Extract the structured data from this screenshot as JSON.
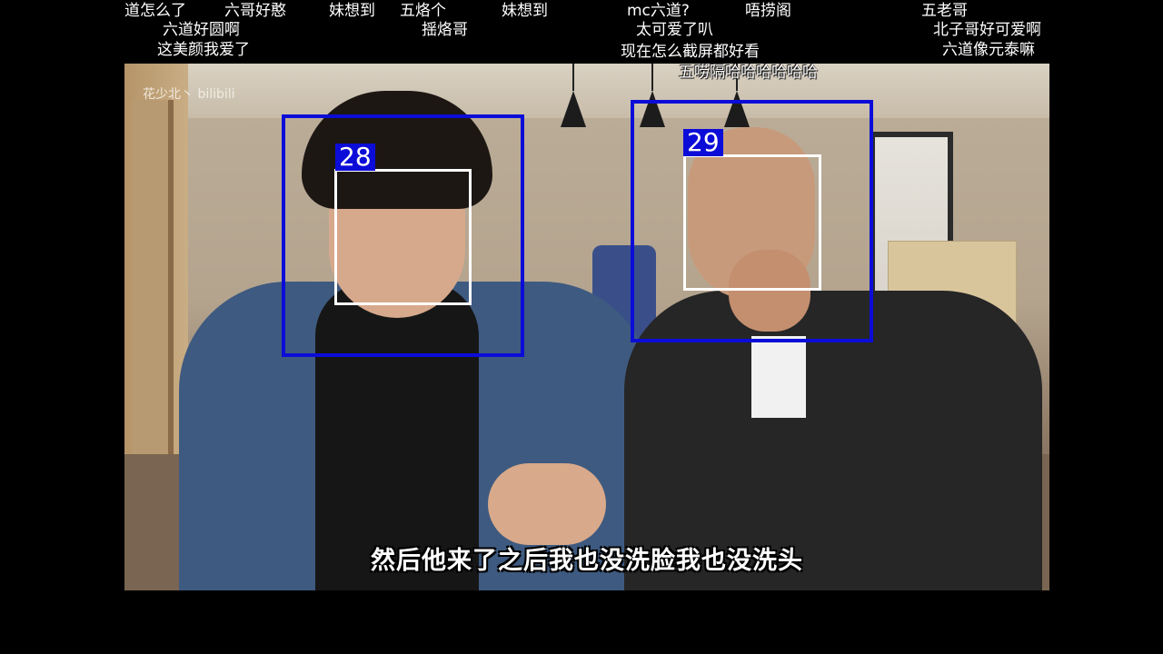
{
  "danmaku": [
    "道怎么了",
    "六哥好憨",
    "妹想到",
    "五烙个",
    "妹想到",
    "mc六道?",
    "唔捞阁",
    "五老哥",
    "六道好圆啊",
    "揺烙哥",
    "太可爱了叭",
    "北子哥好可爱啊",
    "这美颜我爱了",
    "现在怎么截屏都好看",
    "六道像元泰嘛",
    "五唠隔哈哈哈哈哈哈"
  ],
  "video": {
    "watermark": "花少北丶 bilibili",
    "subtitle": "然后他来了之后我也没洗脸我也没洗头",
    "detections": [
      {
        "id": "28"
      },
      {
        "id": "29"
      }
    ]
  },
  "colors": {
    "detection_box": "#0c0cd8",
    "face_box": "#ffffff",
    "background": "#000000"
  }
}
